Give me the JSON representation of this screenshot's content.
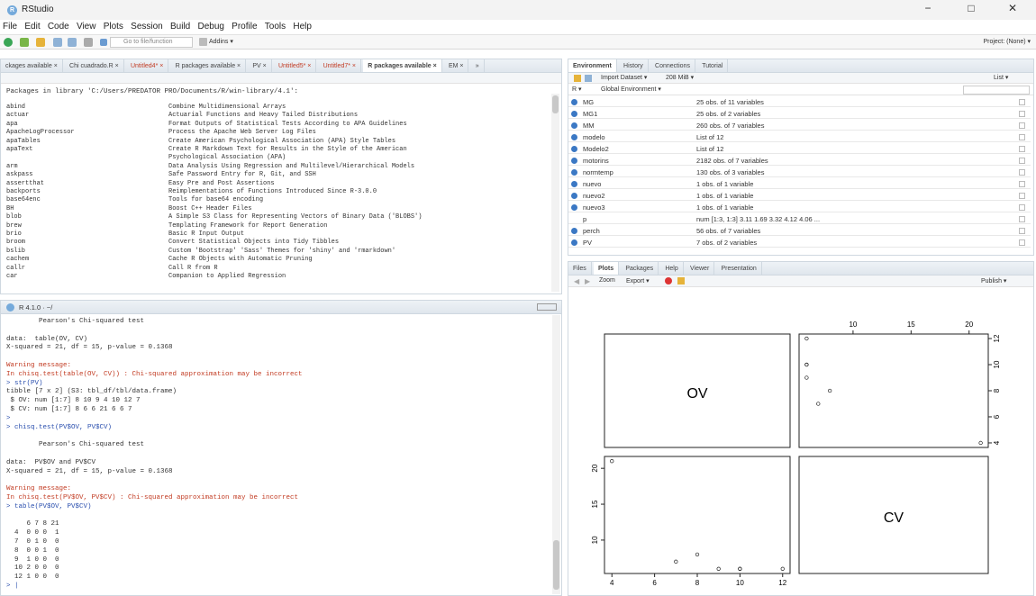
{
  "window": {
    "title": "RStudio",
    "minimize": "−",
    "maximize": "□",
    "close": "✕"
  },
  "menu": [
    "File",
    "Edit",
    "Code",
    "View",
    "Plots",
    "Session",
    "Build",
    "Debug",
    "Profile",
    "Tools",
    "Help"
  ],
  "toolbar": {
    "goto_placeholder": "Go to file/function",
    "addins": "Addins ▾",
    "project": "Project: (None) ▾"
  },
  "editor": {
    "tabs": [
      {
        "label": "ckages available ×",
        "style": "normal"
      },
      {
        "label": "Chi cuadrado.R ×",
        "style": "normal"
      },
      {
        "label": "Untitled4* ×",
        "style": "red"
      },
      {
        "label": "R packages available ×",
        "style": "normal"
      },
      {
        "label": "PV ×",
        "style": "normal"
      },
      {
        "label": "Untitled5* ×",
        "style": "red"
      },
      {
        "label": "Untitled7* ×",
        "style": "red"
      },
      {
        "label": "R packages available ×",
        "style": "active"
      },
      {
        "label": "EM ×",
        "style": "normal"
      },
      {
        "label": "»",
        "style": "normal"
      }
    ],
    "header": "Packages in library 'C:/Users/PREDATOR PRO/Documents/R/win-library/4.1':",
    "packages": [
      [
        "abind",
        "Combine Multidimensional Arrays"
      ],
      [
        "actuar",
        "Actuarial Functions and Heavy Tailed Distributions"
      ],
      [
        "apa",
        "Format Outputs of Statistical Tests According to APA Guidelines"
      ],
      [
        "ApacheLogProcessor",
        "Process the Apache Web Server Log Files"
      ],
      [
        "apaTables",
        "Create American Psychological Association (APA) Style Tables"
      ],
      [
        "apaText",
        "Create R Markdown Text for Results in the Style of the American"
      ],
      [
        "",
        "Psychological Association (APA)"
      ],
      [
        "arm",
        "Data Analysis Using Regression and Multilevel/Hierarchical Models"
      ],
      [
        "askpass",
        "Safe Password Entry for R, Git, and SSH"
      ],
      [
        "assertthat",
        "Easy Pre and Post Assertions"
      ],
      [
        "backports",
        "Reimplementations of Functions Introduced Since R-3.0.0"
      ],
      [
        "base64enc",
        "Tools for base64 encoding"
      ],
      [
        "BH",
        "Boost C++ Header Files"
      ],
      [
        "blob",
        "A Simple S3 Class for Representing Vectors of Binary Data ('BLOBS')"
      ],
      [
        "brew",
        "Templating Framework for Report Generation"
      ],
      [
        "brio",
        "Basic R Input Output"
      ],
      [
        "broom",
        "Convert Statistical Objects into Tidy Tibbles"
      ],
      [
        "bslib",
        "Custom 'Bootstrap' 'Sass' Themes for 'shiny' and 'rmarkdown'"
      ],
      [
        "cachem",
        "Cache R Objects with Automatic Pruning"
      ],
      [
        "callr",
        "Call R from R"
      ],
      [
        "car",
        "Companion to Applied Regression"
      ]
    ]
  },
  "console": {
    "header": "R 4.1.0 · ~/",
    "lines": [
      {
        "t": "        Pearson's Chi-squared test",
        "c": ""
      },
      {
        "t": "",
        "c": ""
      },
      {
        "t": "data:  table(OV, CV)",
        "c": ""
      },
      {
        "t": "X-squared = 21, df = 15, p-value = 0.1368",
        "c": ""
      },
      {
        "t": "",
        "c": ""
      },
      {
        "t": "Warning message:",
        "c": "red"
      },
      {
        "t": "In chisq.test(table(OV, CV)) : Chi-squared approximation may be incorrect",
        "c": "red"
      },
      {
        "t": "> str(PV)",
        "c": "blue"
      },
      {
        "t": "tibble [7 x 2] (S3: tbl_df/tbl/data.frame)",
        "c": ""
      },
      {
        "t": " $ OV: num [1:7] 8 10 9 4 10 12 7",
        "c": ""
      },
      {
        "t": " $ CV: num [1:7] 8 6 6 21 6 6 7",
        "c": ""
      },
      {
        "t": ">",
        "c": "blue"
      },
      {
        "t": "> chisq.test(PV$OV, PV$CV)",
        "c": "blue"
      },
      {
        "t": "",
        "c": ""
      },
      {
        "t": "        Pearson's Chi-squared test",
        "c": ""
      },
      {
        "t": "",
        "c": ""
      },
      {
        "t": "data:  PV$OV and PV$CV",
        "c": ""
      },
      {
        "t": "X-squared = 21, df = 15, p-value = 0.1368",
        "c": ""
      },
      {
        "t": "",
        "c": ""
      },
      {
        "t": "Warning message:",
        "c": "red"
      },
      {
        "t": "In chisq.test(PV$OV, PV$CV) : Chi-squared approximation may be incorrect",
        "c": "red"
      },
      {
        "t": "> table(PV$OV, PV$CV)",
        "c": "blue"
      },
      {
        "t": "",
        "c": ""
      },
      {
        "t": "     6 7 8 21",
        "c": ""
      },
      {
        "t": "  4  0 0 0  1",
        "c": ""
      },
      {
        "t": "  7  0 1 0  0",
        "c": ""
      },
      {
        "t": "  8  0 0 1  0",
        "c": ""
      },
      {
        "t": "  9  1 0 0  0",
        "c": ""
      },
      {
        "t": "  10 2 0 0  0",
        "c": ""
      },
      {
        "t": "  12 1 0 0  0",
        "c": ""
      },
      {
        "t": "> |",
        "c": "blue"
      }
    ]
  },
  "environment": {
    "tabs": [
      "Environment",
      "History",
      "Connections",
      "Tutorial"
    ],
    "import_dataset": "Import Dataset ▾",
    "memory": "208 MiB ▾",
    "list_view": "List ▾",
    "scope_r": "R ▾",
    "scope": "Global Environment ▾",
    "rows": [
      [
        "MG",
        "25 obs. of 11 variables"
      ],
      [
        "MG1",
        "25 obs. of 2 variables"
      ],
      [
        "MM",
        "260 obs. of 7 variables"
      ],
      [
        "modelo",
        "List of 12"
      ],
      [
        "Modelo2",
        "List of 12"
      ],
      [
        "motorins",
        "2182 obs. of 7 variables"
      ],
      [
        "normtemp",
        "130 obs. of 3 variables"
      ],
      [
        "nuevo",
        "1 obs. of 1 variable"
      ],
      [
        "nuevo2",
        "1 obs. of 1 variable"
      ],
      [
        "nuevo3",
        "1 obs. of 1 variable"
      ],
      [
        "p",
        "num [1:3, 1:3] 3.11 1.69 3.32 4.12 4.06 ..."
      ],
      [
        "perch",
        "56 obs. of 7 variables"
      ],
      [
        "PV",
        "7 obs. of 2 variables"
      ]
    ]
  },
  "plots": {
    "tabs": [
      "Files",
      "Plots",
      "Packages",
      "Help",
      "Viewer",
      "Presentation"
    ],
    "zoom": "Zoom",
    "export": "Export ▾",
    "publish": "Publish ▾"
  },
  "chart_data": {
    "type": "scatter",
    "variables": [
      "OV",
      "CV"
    ],
    "OV": [
      8,
      10,
      9,
      4,
      10,
      12,
      7
    ],
    "CV": [
      8,
      6,
      6,
      21,
      6,
      6,
      7
    ],
    "axis_ticks": {
      "OV": [
        4,
        6,
        8,
        10,
        12
      ],
      "CV_left": [
        10,
        15,
        20
      ],
      "CV_top": [
        10,
        15,
        20
      ],
      "OV_right": [
        4,
        6,
        8,
        10,
        12
      ]
    },
    "ranges": {
      "OV": [
        4,
        12
      ],
      "CV": [
        6,
        21
      ]
    }
  }
}
